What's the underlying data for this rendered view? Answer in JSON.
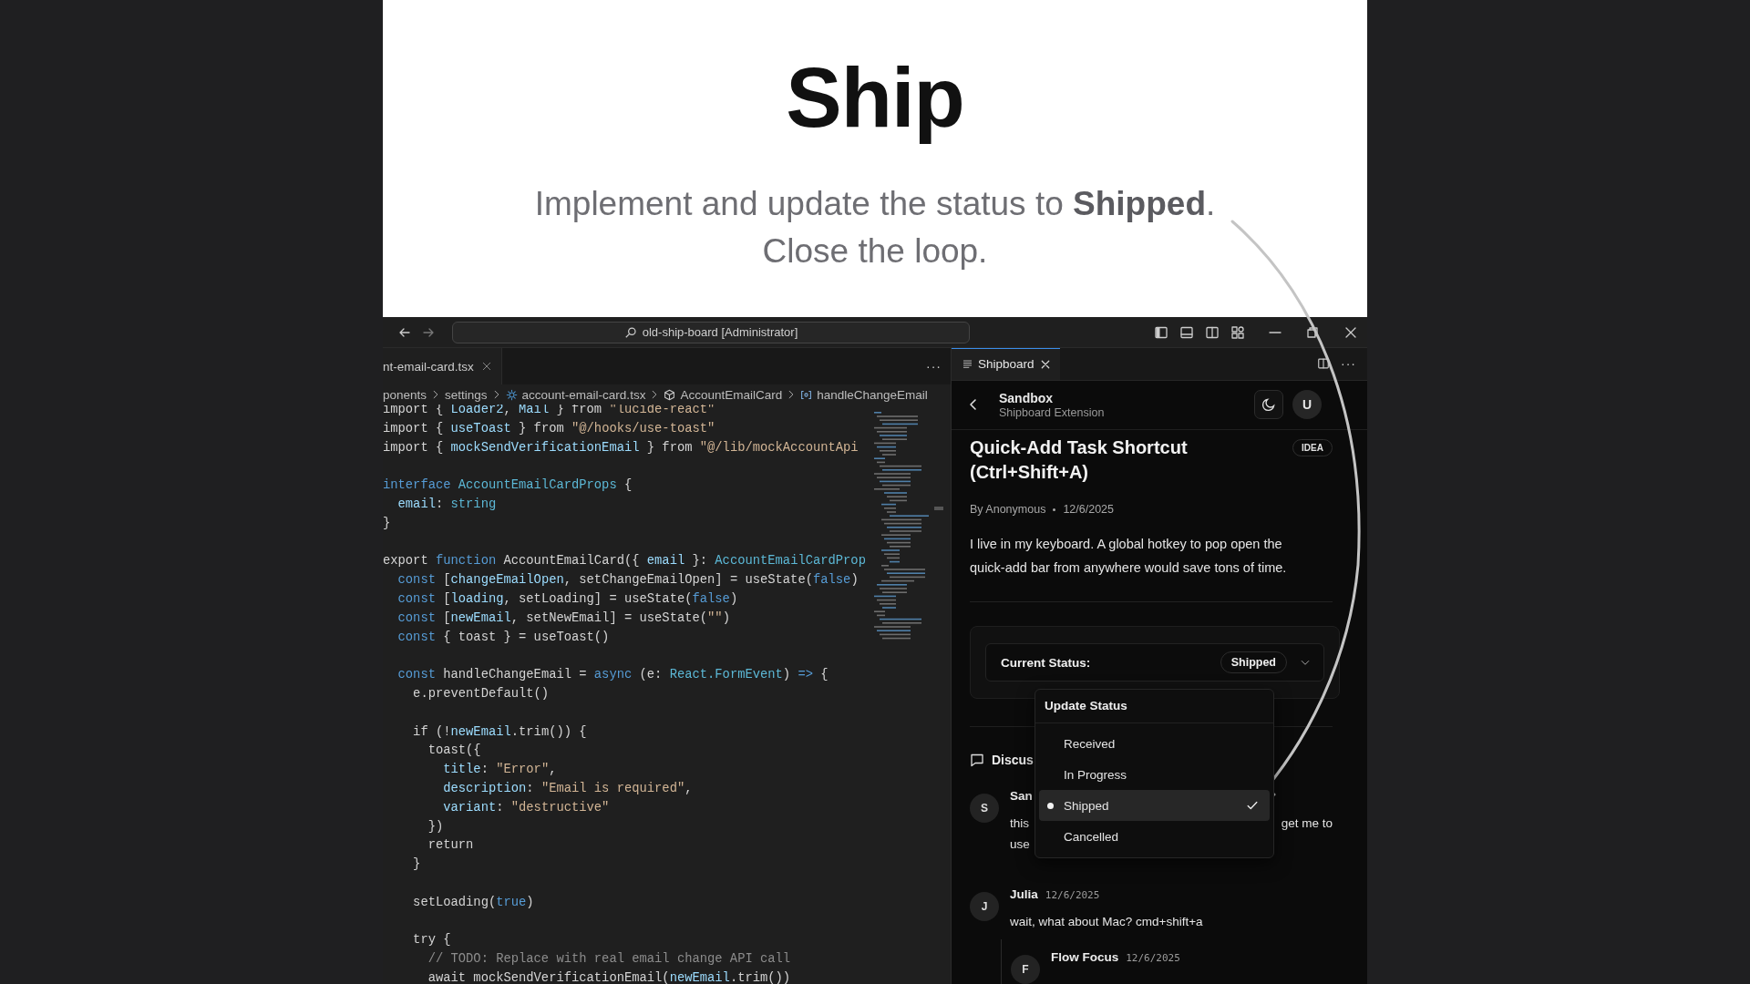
{
  "hero": {
    "title": "Ship",
    "subtitle_lines": [
      "Implement and update the status to **Shipped**.",
      "Close the loop."
    ]
  },
  "titlebar": {
    "search": "old-ship-board [Administrator]"
  },
  "editor": {
    "tab": "nt-email-card.tsx",
    "more": "···",
    "breadcrumb": [
      {
        "label": "ponents",
        "kind": "folder"
      },
      {
        "label": "settings",
        "kind": "folder"
      },
      {
        "label": "account-email-card.tsx",
        "kind": "file"
      },
      {
        "label": "AccountEmailCard",
        "kind": "component"
      },
      {
        "label": "handleChangeEmail",
        "kind": "function"
      }
    ],
    "lines": [
      {
        "kind": "code",
        "tokens": [
          {
            "text": "import { ",
            "kind": "plain"
          },
          {
            "text": "Loader2",
            "kind": "variable"
          },
          {
            "text": ", ",
            "kind": "plain"
          },
          {
            "text": "Mail",
            "kind": "variable"
          },
          {
            "text": " } from ",
            "kind": "plain"
          },
          {
            "text": "\"lucide-react\"",
            "kind": "string"
          }
        ]
      },
      {
        "kind": "code",
        "tokens": [
          {
            "text": "import { ",
            "kind": "plain"
          },
          {
            "text": "useToast",
            "kind": "variable"
          },
          {
            "text": " } from ",
            "kind": "plain"
          },
          {
            "text": "\"@/hooks/use-toast\"",
            "kind": "string"
          }
        ]
      },
      {
        "kind": "code",
        "tokens": [
          {
            "text": "import { ",
            "kind": "plain"
          },
          {
            "text": "mockSendVerificationEmail",
            "kind": "variable"
          },
          {
            "text": " } from ",
            "kind": "plain"
          },
          {
            "text": "\"@/lib/mockAccountApi",
            "kind": "string"
          }
        ]
      },
      {
        "kind": "blank"
      },
      {
        "kind": "code",
        "tokens": [
          {
            "text": "interface",
            "kind": "keyword"
          },
          {
            "text": " AccountEmailCardProps",
            "kind": "type"
          },
          {
            "text": " {",
            "kind": "plain"
          }
        ]
      },
      {
        "kind": "code",
        "tokens": [
          {
            "text": "  email",
            "kind": "variable"
          },
          {
            "text": ": ",
            "kind": "plain"
          },
          {
            "text": "string",
            "kind": "type"
          }
        ]
      },
      {
        "kind": "code",
        "tokens": [
          {
            "text": "}",
            "kind": "plain"
          }
        ]
      },
      {
        "kind": "blank"
      },
      {
        "kind": "code",
        "tokens": [
          {
            "text": "export ",
            "kind": "plain"
          },
          {
            "text": "function",
            "kind": "keyword"
          },
          {
            "text": " AccountEmailCard({ ",
            "kind": "plain"
          },
          {
            "text": "email",
            "kind": "variable"
          },
          {
            "text": " }: ",
            "kind": "plain"
          },
          {
            "text": "AccountEmailCardProp",
            "kind": "type"
          }
        ]
      },
      {
        "kind": "code",
        "tokens": [
          {
            "text": "  const",
            "kind": "keyword"
          },
          {
            "text": " [",
            "kind": "plain"
          },
          {
            "text": "changeEmailOpen",
            "kind": "variable"
          },
          {
            "text": ", setChangeEmailOpen] = useState(",
            "kind": "plain"
          },
          {
            "text": "false",
            "kind": "keyword"
          },
          {
            "text": ")",
            "kind": "plain"
          }
        ]
      },
      {
        "kind": "code",
        "tokens": [
          {
            "text": "  const",
            "kind": "keyword"
          },
          {
            "text": " [",
            "kind": "plain"
          },
          {
            "text": "loading",
            "kind": "variable"
          },
          {
            "text": ", setLoading] = useState(",
            "kind": "plain"
          },
          {
            "text": "false",
            "kind": "keyword"
          },
          {
            "text": ")",
            "kind": "plain"
          }
        ]
      },
      {
        "kind": "code",
        "tokens": [
          {
            "text": "  const",
            "kind": "keyword"
          },
          {
            "text": " [",
            "kind": "plain"
          },
          {
            "text": "newEmail",
            "kind": "variable"
          },
          {
            "text": ", setNewEmail] = useState(",
            "kind": "plain"
          },
          {
            "text": "\"\"",
            "kind": "string"
          },
          {
            "text": ")",
            "kind": "plain"
          }
        ]
      },
      {
        "kind": "code",
        "tokens": [
          {
            "text": "  const",
            "kind": "keyword"
          },
          {
            "text": " { toast } = useToast()",
            "kind": "plain"
          }
        ]
      },
      {
        "kind": "blank"
      },
      {
        "kind": "code",
        "tokens": [
          {
            "text": "  const",
            "kind": "keyword"
          },
          {
            "text": " handleChangeEmail = ",
            "kind": "plain"
          },
          {
            "text": "async",
            "kind": "keyword"
          },
          {
            "text": " (e: ",
            "kind": "plain"
          },
          {
            "text": "React.FormEvent",
            "kind": "type"
          },
          {
            "text": ") ",
            "kind": "plain"
          },
          {
            "text": "=>",
            "kind": "keyword"
          },
          {
            "text": " {",
            "kind": "plain"
          }
        ]
      },
      {
        "kind": "code",
        "tokens": [
          {
            "text": "    e.preventDefault()",
            "kind": "plain"
          }
        ]
      },
      {
        "kind": "blank"
      },
      {
        "kind": "code",
        "tokens": [
          {
            "text": "    if (!",
            "kind": "plain"
          },
          {
            "text": "newEmail",
            "kind": "variable"
          },
          {
            "text": ".trim()) {",
            "kind": "plain"
          }
        ]
      },
      {
        "kind": "code",
        "tokens": [
          {
            "text": "      toast({",
            "kind": "plain"
          }
        ]
      },
      {
        "kind": "code",
        "tokens": [
          {
            "text": "        title",
            "kind": "variable"
          },
          {
            "text": ": ",
            "kind": "plain"
          },
          {
            "text": "\"Error\"",
            "kind": "string"
          },
          {
            "text": ",",
            "kind": "plain"
          }
        ]
      },
      {
        "kind": "code",
        "tokens": [
          {
            "text": "        description",
            "kind": "variable"
          },
          {
            "text": ": ",
            "kind": "plain"
          },
          {
            "text": "\"Email is required\"",
            "kind": "string"
          },
          {
            "text": ",",
            "kind": "plain"
          }
        ]
      },
      {
        "kind": "code",
        "tokens": [
          {
            "text": "        variant",
            "kind": "variable"
          },
          {
            "text": ": ",
            "kind": "plain"
          },
          {
            "text": "\"destructive\"",
            "kind": "string"
          }
        ]
      },
      {
        "kind": "code",
        "tokens": [
          {
            "text": "      })",
            "kind": "plain"
          }
        ]
      },
      {
        "kind": "code",
        "tokens": [
          {
            "text": "      return",
            "kind": "plain"
          }
        ]
      },
      {
        "kind": "code",
        "tokens": [
          {
            "text": "    }",
            "kind": "plain"
          }
        ]
      },
      {
        "kind": "blank"
      },
      {
        "kind": "code",
        "tokens": [
          {
            "text": "    setLoading(",
            "kind": "plain"
          },
          {
            "text": "true",
            "kind": "keyword"
          },
          {
            "text": ")",
            "kind": "plain"
          }
        ]
      },
      {
        "kind": "blank"
      },
      {
        "kind": "code",
        "tokens": [
          {
            "text": "    try {",
            "kind": "plain"
          }
        ]
      },
      {
        "kind": "code",
        "tokens": [
          {
            "text": "      // TODO: Replace with real email change API call",
            "kind": "comment"
          }
        ]
      },
      {
        "kind": "code",
        "tokens": [
          {
            "text": "      await mockSendVerificationEmail(",
            "kind": "plain"
          },
          {
            "text": "newEmail",
            "kind": "variable"
          },
          {
            "text": ".trim())",
            "kind": "plain"
          }
        ]
      }
    ]
  },
  "panel": {
    "tab": "Shipboard",
    "more": "···",
    "workspace": "Sandbox",
    "workspace_subtitle": "Shipboard Extension",
    "avatar": "U",
    "task": {
      "title": "Quick-Add Task Shortcut (Ctrl+Shift+A)",
      "tag": "IDEA",
      "author": "By Anonymous",
      "date": "12/6/2025",
      "description": "I live in my keyboard. A global hotkey to pop open the quick-add bar from anywhere would save tons of time."
    },
    "status": {
      "label": "Current Status:",
      "value": "Shipped"
    },
    "menu": {
      "title": "Update Status",
      "options": [
        {
          "label": "Received",
          "selected": false
        },
        {
          "label": "In Progress",
          "selected": false
        },
        {
          "label": "Shipped",
          "selected": true
        },
        {
          "label": "Cancelled",
          "selected": false
        }
      ]
    },
    "discussion": {
      "heading": "Discus",
      "comments": [
        {
          "avatar": "S",
          "author": "San",
          "body_lines": [
            {
              "left": "this",
              "right": "get me to"
            },
            {
              "left": "use"
            }
          ]
        },
        {
          "avatar": "J",
          "author": "Julia",
          "date": "12/6/2025",
          "body": "wait, what about Mac? cmd+shift+a",
          "replies": [
            {
              "avatar": "F",
              "author": "Flow Focus",
              "date": "12/6/2025"
            }
          ]
        }
      ]
    }
  }
}
